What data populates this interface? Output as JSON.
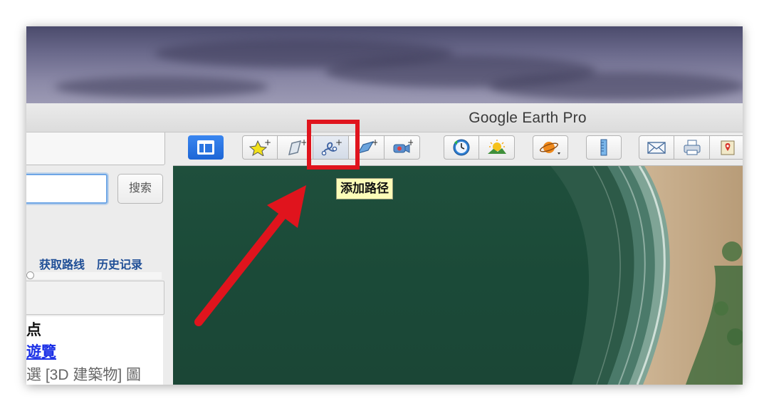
{
  "window": {
    "title": "Google Earth Pro"
  },
  "search": {
    "placeholder": "",
    "button_label": "搜索",
    "links": [
      "获取路线",
      "历史记录"
    ]
  },
  "places": {
    "line1": "点",
    "line2": "遊覽",
    "line3": "選 [3D 建築物] 圖"
  },
  "toolbar": {
    "buttons": [
      {
        "name": "sidebar-toggle",
        "icon": "sidebar-icon"
      },
      {
        "name": "add-placemark",
        "icon": "placemark-icon"
      },
      {
        "name": "add-polygon",
        "icon": "polygon-icon"
      },
      {
        "name": "add-path",
        "icon": "path-icon"
      },
      {
        "name": "add-image-overlay",
        "icon": "image-overlay-icon"
      },
      {
        "name": "record-tour",
        "icon": "camera-icon"
      },
      {
        "name": "historical-imagery",
        "icon": "clock-icon"
      },
      {
        "name": "sunlight",
        "icon": "sun-icon"
      },
      {
        "name": "switch-planet",
        "icon": "planet-icon"
      },
      {
        "name": "ruler",
        "icon": "ruler-icon"
      },
      {
        "name": "email",
        "icon": "envelope-icon"
      },
      {
        "name": "print",
        "icon": "printer-icon"
      },
      {
        "name": "view-in-maps",
        "icon": "map-icon"
      }
    ]
  },
  "tooltip": {
    "text": "添加路径"
  },
  "colors": {
    "highlight": "#e0141d",
    "arrow": "#e0141d",
    "tooltip_bg": "#fcfcb8",
    "accent": "#1d66d6"
  }
}
